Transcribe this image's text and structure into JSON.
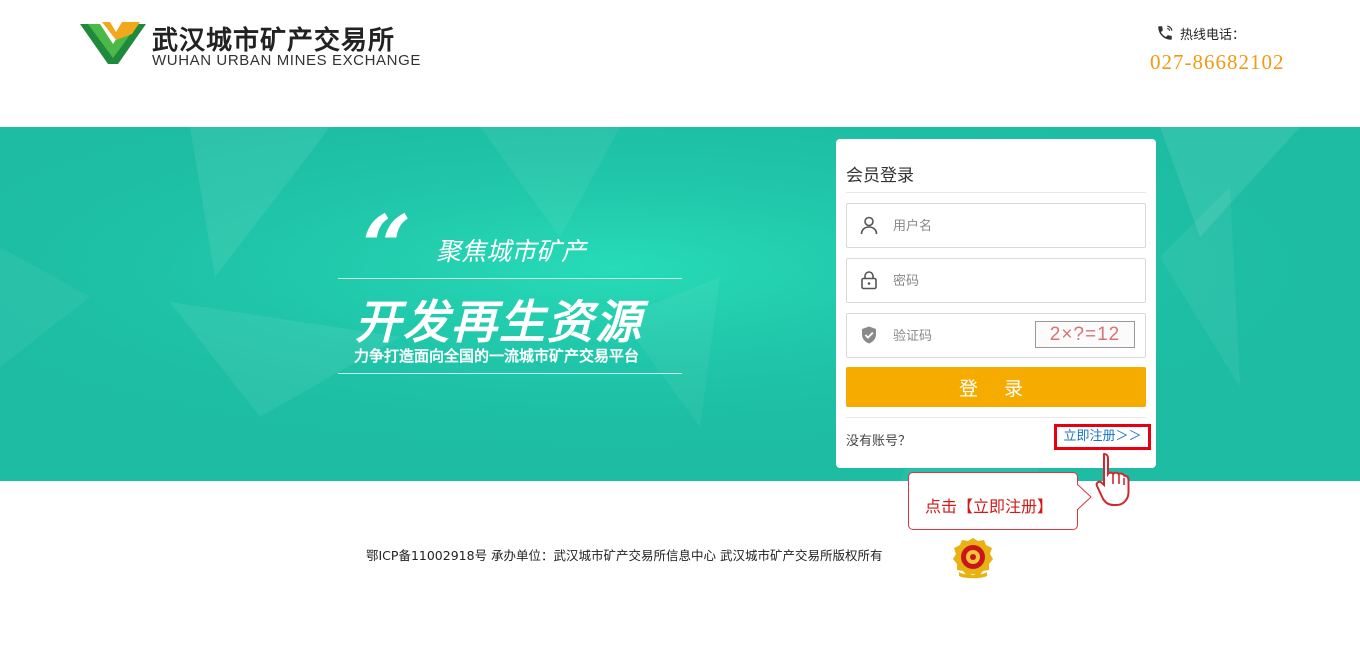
{
  "header": {
    "logo_cn": "武汉城市矿产交易所",
    "logo_en": "WUHAN URBAN MINES EXCHANGE",
    "hotline_label": "热线电话：",
    "hotline_number": "027-86682102",
    "phone_icon": "phone-icon"
  },
  "banner": {
    "quote_mark": "“",
    "subtitle": "聚焦城市矿产",
    "headline": "开发再生资源",
    "tagline": "力争打造面向全国的一流城市矿产交易平台"
  },
  "login": {
    "title": "会员登录",
    "username_placeholder": "用户名",
    "password_placeholder": "密码",
    "captcha_placeholder": "验证码",
    "captcha_text": "2×?=12",
    "submit_label": "登 录",
    "no_account_text": "没有账号？",
    "register_link": "立即注册＞＞"
  },
  "annotation": {
    "callout_text": "点击【立即注册】"
  },
  "footer": {
    "text": "鄂ICP备11002918号  承办单位：武汉城市矿产交易所信息中心  武汉城市矿产交易所版权所有"
  },
  "colors": {
    "banner": "#1fc1a6",
    "login_button": "#f5ab00",
    "hotline": "#f29a12",
    "register_border": "#e60012",
    "link": "#1a73c5"
  }
}
